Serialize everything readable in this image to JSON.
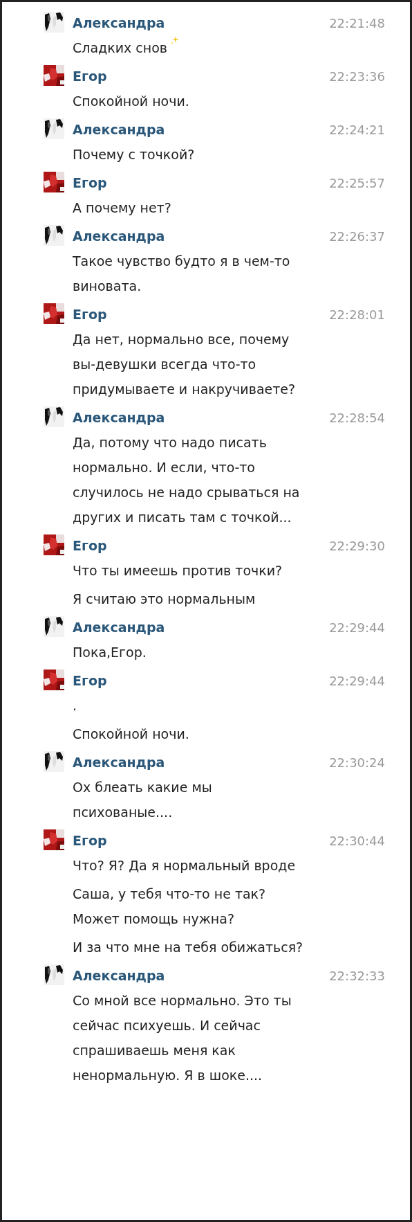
{
  "messages": [
    {
      "author": "Александра",
      "kind": "contact",
      "time": "22:21:48",
      "texts": [
        "Сладких снов"
      ],
      "emoji": true
    },
    {
      "author": "Егор",
      "kind": "self",
      "time": "22:23:36",
      "texts": [
        "Спокойной ночи."
      ]
    },
    {
      "author": "Александра",
      "kind": "contact",
      "time": "22:24:21",
      "texts": [
        "Почему с точкой?"
      ]
    },
    {
      "author": "Егор",
      "kind": "self",
      "time": "22:25:57",
      "texts": [
        "А почему нет?"
      ]
    },
    {
      "author": "Александра",
      "kind": "contact",
      "time": "22:26:37",
      "texts": [
        "Такое чувство будто я в чем-то виновата."
      ]
    },
    {
      "author": "Егор",
      "kind": "self",
      "time": "22:28:01",
      "texts": [
        "Да нет, нормально все, почему вы-девушки всегда что-то придумываете и накручиваете?"
      ]
    },
    {
      "author": "Александра",
      "kind": "contact",
      "time": "22:28:54",
      "texts": [
        "Да, потому что надо писать нормально. И если, что-то случилось не надо срываться на других и писать там с точкой..."
      ]
    },
    {
      "author": "Егор",
      "kind": "self",
      "time": "22:29:30",
      "texts": [
        "Что ты имеешь против точки?",
        "Я считаю это нормальным"
      ]
    },
    {
      "author": "Александра",
      "kind": "contact",
      "time": "22:29:44",
      "texts": [
        "Пока,Егор."
      ]
    },
    {
      "author": "Егор",
      "kind": "self",
      "time": "22:29:44",
      "texts": [
        ".",
        "Спокойной ночи."
      ]
    },
    {
      "author": "Александра",
      "kind": "contact",
      "time": "22:30:24",
      "texts": [
        "Ох блеать какие мы психованые...."
      ]
    },
    {
      "author": "Егор",
      "kind": "self",
      "time": "22:30:44",
      "texts": [
        "Что? Я? Да я нормальный вроде",
        "Саша, у тебя что-то не так? Может помощь нужна?",
        "И за что мне на тебя обижаться?"
      ]
    },
    {
      "author": "Александра",
      "kind": "contact",
      "time": "22:32:33",
      "texts": [
        "Со мной все нормально. Это ты сейчас психуешь. И сейчас спрашиваешь меня как ненормальную. Я в шоке...."
      ]
    }
  ]
}
